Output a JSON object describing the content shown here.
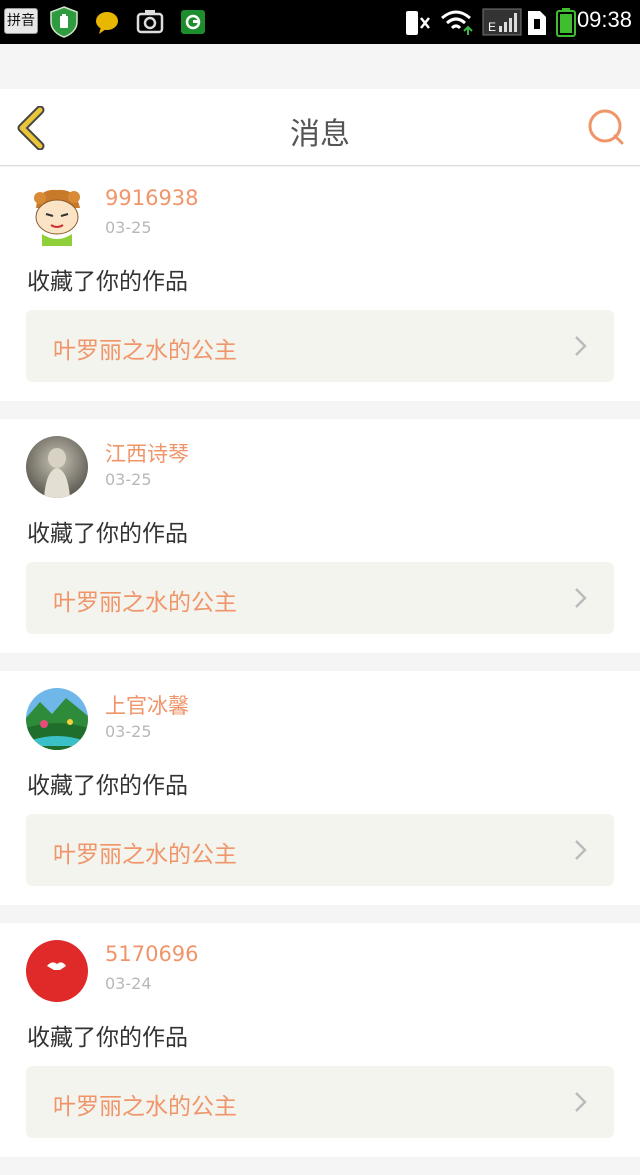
{
  "status_bar": {
    "ime_label": "拼音",
    "time": "09:38",
    "network": "E",
    "icons": [
      "ime-icon",
      "shield-icon",
      "chat-bubble-icon",
      "camera-icon",
      "app-icon",
      "mute-icon",
      "wifi-icon",
      "signal-icon",
      "sim-icon",
      "battery-icon"
    ]
  },
  "header": {
    "title": "消息",
    "back_icon": "chevron-left-icon",
    "search_icon": "search-icon"
  },
  "messages": [
    {
      "username": "9916938",
      "date": "03-25",
      "action": "收藏了你的作品",
      "work_title": "叶罗丽之水的公主",
      "avatar": "cartoon-avatar"
    },
    {
      "username": "江西诗琴",
      "date": "03-25",
      "action": "收藏了你的作品",
      "work_title": "叶罗丽之水的公主",
      "avatar": "photo-avatar"
    },
    {
      "username": "上官冰馨",
      "date": "03-25",
      "action": "收藏了你的作品",
      "work_title": "叶罗丽之水的公主",
      "avatar": "landscape-avatar"
    },
    {
      "username": "5170696",
      "date": "03-24",
      "action": "收藏了你的作品",
      "work_title": "叶罗丽之水的公主",
      "avatar": "red-avatar"
    }
  ],
  "colors": {
    "accent": "#f0956a",
    "back_arrow": "#e8c53a",
    "card_bg": "#ffffff",
    "work_bg": "#f4f4ee"
  }
}
